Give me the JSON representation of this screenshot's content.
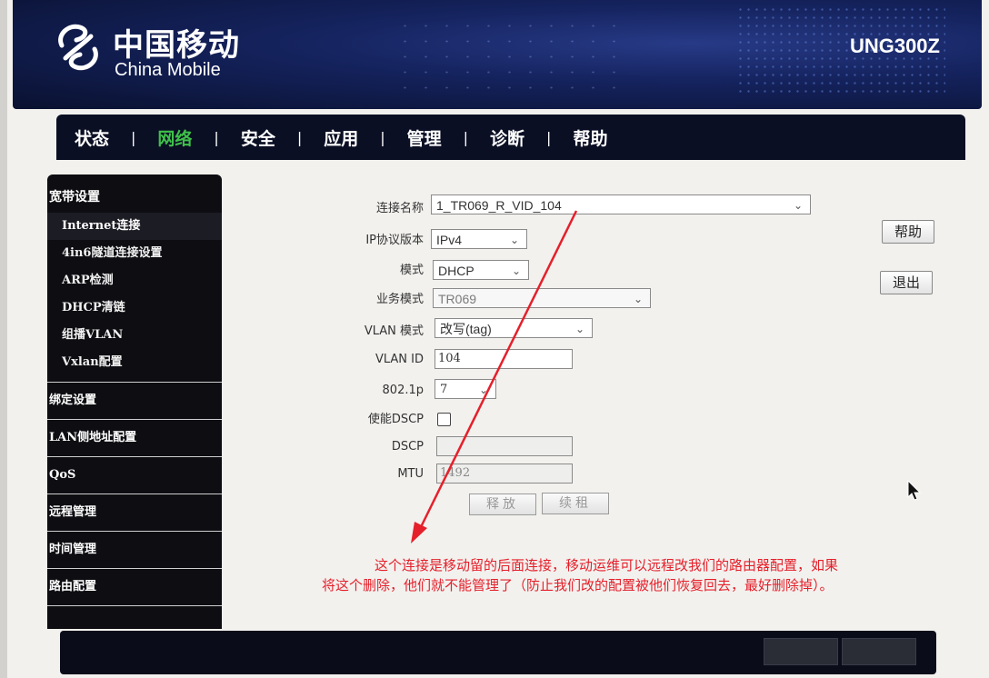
{
  "header": {
    "brand_cn": "中国移动",
    "brand_en": "China Mobile",
    "model": "UNG300Z"
  },
  "nav": {
    "items": [
      "状态",
      "网络",
      "安全",
      "应用",
      "管理",
      "诊断",
      "帮助"
    ],
    "active": "网络",
    "separator": "|"
  },
  "sidebar": {
    "section_title": "宽带设置",
    "sub_items": [
      "Internet连接",
      "4in6隧道连接设置",
      "ARP检测",
      "DHCP清链",
      "组播VLAN",
      "Vxlan配置"
    ],
    "selected": "Internet连接",
    "groups": [
      "绑定设置",
      "LAN侧地址配置",
      "QoS",
      "远程管理",
      "时间管理",
      "路由配置"
    ]
  },
  "form": {
    "connection_name": {
      "label": "连接名称",
      "value": "1_TR069_R_VID_104"
    },
    "ip_version": {
      "label": "IP协议版本",
      "value": "IPv4"
    },
    "mode": {
      "label": "模式",
      "value": "DHCP"
    },
    "service_mode": {
      "label": "业务模式",
      "value": "TR069"
    },
    "vlan_mode": {
      "label": "VLAN 模式",
      "value": "改写(tag)"
    },
    "vlan_id": {
      "label": "VLAN ID",
      "value": "104"
    },
    "dot1p": {
      "label": "802.1p",
      "value": "7"
    },
    "enable_dscp": {
      "label": "使能DSCP",
      "checked": false
    },
    "dscp": {
      "label": "DSCP",
      "value": ""
    },
    "mtu": {
      "label": "MTU",
      "value": "1492"
    },
    "release_label": "释放",
    "renew_label": "续租"
  },
  "right_buttons": {
    "help": "帮助",
    "logout": "退出"
  },
  "annotation": {
    "line1": "这个连接是移动留的后面连接，移动运维可以远程改我们的路由器配置，如果",
    "line2": "将这个删除，他们就不能管理了（防止我们改的配置被他们恢复回去，最好删除掉）。",
    "color": "#e5202b"
  },
  "colors": {
    "nav_active": "#3fc14a",
    "banner": "#15235f",
    "sidebar": "#0d0d12"
  }
}
